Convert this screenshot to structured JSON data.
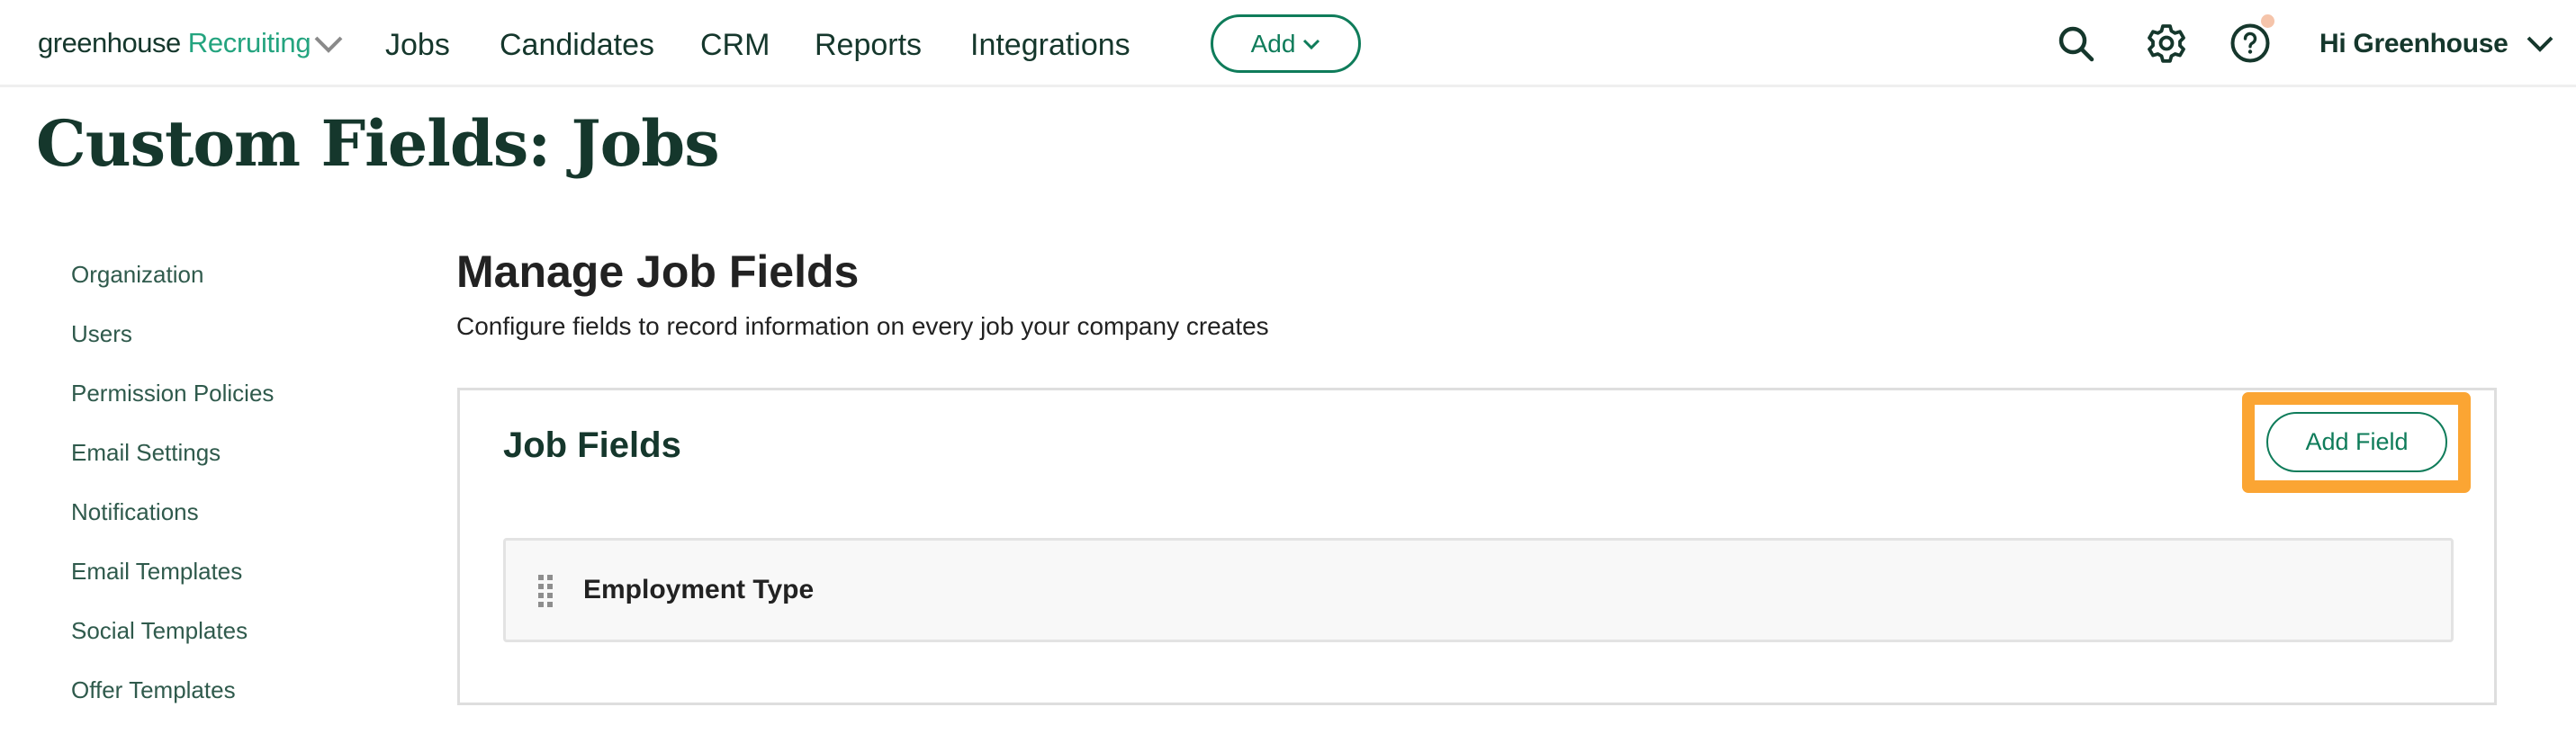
{
  "header": {
    "logo": {
      "brand": "greenhouse",
      "product": "Recruiting",
      "chevron_icon": "chevron-down-icon"
    },
    "nav": [
      {
        "label": "Jobs"
      },
      {
        "label": "Candidates"
      },
      {
        "label": "CRM"
      },
      {
        "label": "Reports"
      },
      {
        "label": "Integrations"
      }
    ],
    "add_button": {
      "label": "Add",
      "icon": "chevron-down-icon"
    },
    "icons": {
      "search": "search-icon",
      "settings": "gear-icon",
      "help": "help-icon",
      "help_notification": "notification-dot"
    },
    "user_menu": {
      "label": "Hi Greenhouse",
      "icon": "chevron-down-icon"
    }
  },
  "page": {
    "title": "Custom Fields: Jobs"
  },
  "sidebar": {
    "items": [
      {
        "label": "Organization"
      },
      {
        "label": "Users"
      },
      {
        "label": "Permission Policies"
      },
      {
        "label": "Email Settings"
      },
      {
        "label": "Notifications"
      },
      {
        "label": "Email Templates"
      },
      {
        "label": "Social Templates"
      },
      {
        "label": "Offer Templates"
      }
    ]
  },
  "main": {
    "title": "Manage Job Fields",
    "description": "Configure fields to record information on every job your company creates",
    "card": {
      "title": "Job Fields",
      "add_field_label": "Add Field",
      "highlighted": true,
      "fields": [
        {
          "name": "Employment Type",
          "icon": "drag-handle-icon"
        }
      ]
    }
  },
  "colors": {
    "brand_dark": "#15372c",
    "brand_green": "#24a47f",
    "button_green": "#0f7c5a",
    "highlight_orange": "#fba533",
    "notification_dot": "#f5c4aa"
  }
}
